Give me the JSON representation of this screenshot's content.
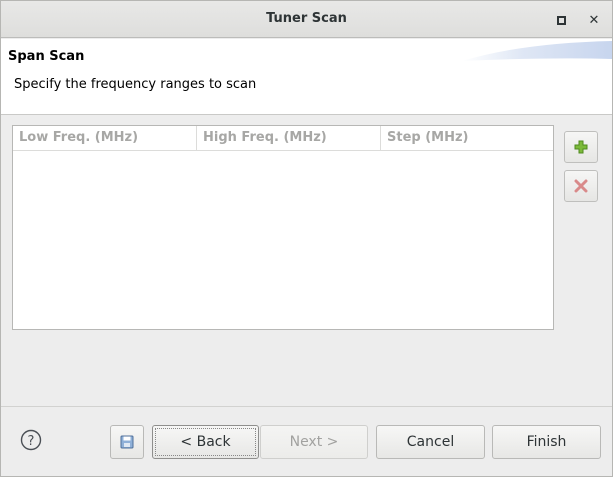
{
  "window": {
    "title": "Tuner Scan"
  },
  "wizard": {
    "title": "Span Scan",
    "description": "Specify the frequency ranges to scan"
  },
  "table": {
    "columns": [
      "Low Freq. (MHz)",
      "High Freq. (MHz)",
      "Step (MHz)"
    ],
    "rows": []
  },
  "buttons": {
    "back": "< Back",
    "next": "Next >",
    "cancel": "Cancel",
    "finish": "Finish"
  },
  "icons": {
    "maximize": "maximize-icon",
    "close": "close-icon",
    "add": "plus-icon",
    "remove": "red-x-icon",
    "help": "question-mark-icon",
    "save": "floppy-disk-icon"
  },
  "colors": {
    "add_icon": "#6aa32a",
    "remove_icon": "#d07a7a",
    "banner": "#d4dff2"
  }
}
